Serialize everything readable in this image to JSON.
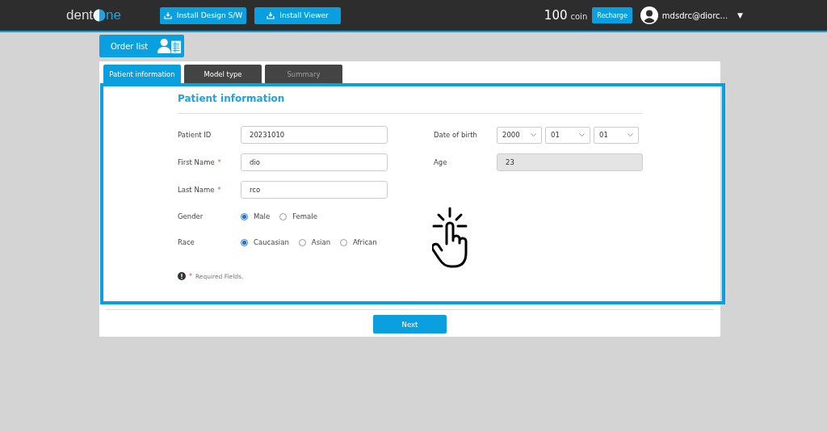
{
  "header": {
    "logo": {
      "left": "dent",
      "right": "ne"
    },
    "buttons": [
      {
        "label": "Install Design S/W"
      },
      {
        "label": "Install Viewer"
      }
    ],
    "coin_amount": "100",
    "coin_unit": "coin",
    "recharge": "Recharge",
    "user": "mdsdrc@diorc...",
    "menu_caret": "▼"
  },
  "order_list": "Order list",
  "tabs": [
    {
      "label": "Patient information",
      "selected": true,
      "disabled": false
    },
    {
      "label": "Model type",
      "selected": false,
      "disabled": false
    },
    {
      "label": "Summary",
      "selected": false,
      "disabled": true
    }
  ],
  "form": {
    "title": "Patient information",
    "required_mark": "*",
    "fields": [
      {
        "label": "Patient ID",
        "value": "20231010"
      },
      {
        "label": "First Name",
        "required_mark": "*",
        "value": "dio"
      },
      {
        "label": "Last Name",
        "required_mark": "*",
        "value": "rco"
      }
    ],
    "radio_groups": [
      {
        "label": "Gender",
        "options": [
          {
            "label": "Male",
            "selected": true
          },
          {
            "label": "Female",
            "selected": false
          }
        ]
      },
      {
        "label": "Race",
        "options": [
          {
            "label": "Caucasian",
            "selected": true
          },
          {
            "label": "Asian",
            "selected": false
          },
          {
            "label": "African",
            "selected": false
          }
        ]
      }
    ],
    "date_of_birth": {
      "label": "Date of birth",
      "selects": [
        {
          "value": "2000"
        },
        {
          "value": "01"
        },
        {
          "value": "01"
        }
      ]
    },
    "age": {
      "label": "Age",
      "value": "23",
      "disabled": true
    },
    "required_note": "Required Fields."
  },
  "next_button": "Next"
}
